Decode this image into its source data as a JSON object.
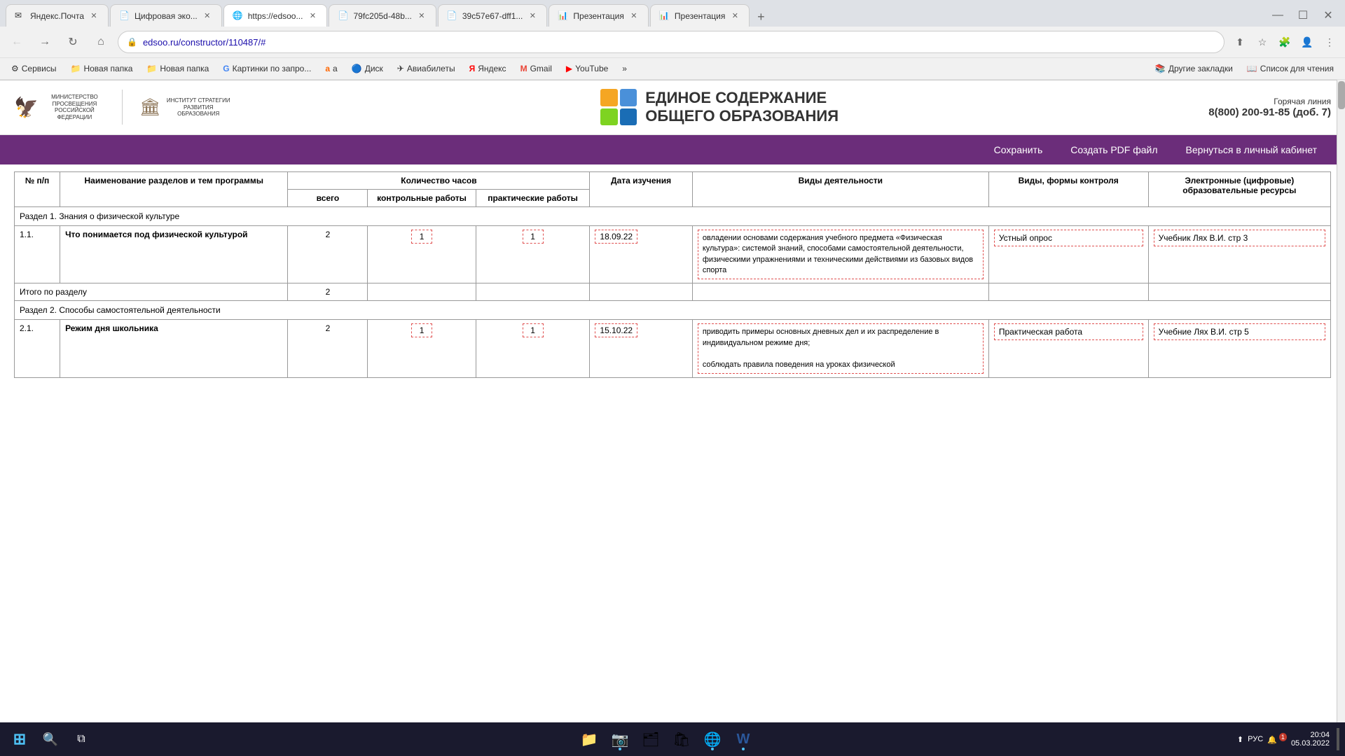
{
  "browser": {
    "tabs": [
      {
        "id": 1,
        "label": "Яндекс.Почта",
        "favicon": "✉",
        "active": false
      },
      {
        "id": 2,
        "label": "Цифровая эко...",
        "favicon": "📄",
        "active": false
      },
      {
        "id": 3,
        "label": "https://edsoo...",
        "favicon": "🌐",
        "active": true
      },
      {
        "id": 4,
        "label": "79fc205d-48b...",
        "favicon": "📄",
        "active": false
      },
      {
        "id": 5,
        "label": "39c57e67-dff1...",
        "favicon": "📄",
        "active": false
      },
      {
        "id": 6,
        "label": "Презентация",
        "favicon": "📊",
        "active": false
      },
      {
        "id": 7,
        "label": "Презентация",
        "favicon": "📊",
        "active": false
      }
    ],
    "address": "edsoo.ru/constructor/110487/#",
    "bookmarks": [
      {
        "label": "Сервисы",
        "favicon": "⚙"
      },
      {
        "label": "Новая папка",
        "favicon": "📁"
      },
      {
        "label": "Новая папка",
        "favicon": "📁"
      },
      {
        "label": "Картинки по запро...",
        "favicon": "G"
      },
      {
        "label": "a",
        "favicon": "🅰"
      },
      {
        "label": "Диск",
        "favicon": "🔵"
      },
      {
        "label": "Авиабилеты",
        "favicon": "✈"
      },
      {
        "label": "Яндекс",
        "favicon": "Я"
      },
      {
        "label": "Gmail",
        "favicon": "M"
      },
      {
        "label": "YouTube",
        "favicon": "▶"
      },
      {
        "label": "»",
        "favicon": ""
      },
      {
        "label": "Другие закладки",
        "favicon": "📚"
      },
      {
        "label": "Список для чтения",
        "favicon": "📖"
      }
    ]
  },
  "site": {
    "ministry_name": "МИНИСТЕРСТВО ПРОСВЕЩЕНИЯ РОССИЙСКОЙ ФЕДЕРАЦИИ",
    "institute_name": "ИНСТИТУТ СТРАТЕГИИ РАЗВИТИЯ ОБРАЗОВАНИЯ",
    "title_line1": "ЕДИНОЕ СОДЕРЖАНИЕ",
    "title_line2": "ОБЩЕГО ОБРАЗОВАНИЯ",
    "hotline_label": "Горячая линия",
    "hotline_number": "8(800) 200-91-85",
    "hotline_ext": "(доб. 7)"
  },
  "nav": {
    "items": [
      "Сохранить",
      "Создать PDF файл",
      "Вернуться в личный кабинет"
    ]
  },
  "table": {
    "headers": {
      "num": "№ п/п",
      "name": "Наименование разделов и тем программы",
      "hours_group": "Количество часов",
      "hours_total": "всего",
      "hours_control": "контрольные работы",
      "hours_practice": "практические работы",
      "date": "Дата изучения",
      "activity": "Виды деятельности",
      "control_types": "Виды, формы контроля",
      "resources": "Электронные (цифровые) образовательные ресурсы"
    },
    "sections": [
      {
        "id": "section1",
        "label": "Раздел 1. Знания о физической культуре",
        "rows": [
          {
            "num": "1.1.",
            "name": "Что понимается под физической культурой",
            "hours_total": "2",
            "hours_control": "1",
            "hours_practice": "1",
            "date": "18.09.22",
            "activity": "овладении основами содержания учебного предмета «Физическая культура»: системой знаний, способами самостоятельной деятельности, физическими упражнениями и техническими действиями из базовых видов спорта",
            "control_type": "Устный опрос",
            "resource": "Учебник Лях В.И. стр 3"
          }
        ],
        "total_hours": "2"
      },
      {
        "id": "section2",
        "label": "Раздел 2. Способы самостоятельной деятельности",
        "rows": [
          {
            "num": "2.1.",
            "name": "Режим дня школьника",
            "hours_total": "2",
            "hours_control": "1",
            "hours_practice": "1",
            "date": "15.10.22",
            "activity": "приводить примеры основных дневных дел и их распределение в индивидуальном режиме дня;\n\nсоблюдать правила поведения на уроках физической",
            "control_type": "Практическая работа",
            "resource": "Учебние Лях В.И. стр 5"
          }
        ]
      }
    ]
  },
  "taskbar": {
    "time": "20:04",
    "date": "05.03.2022",
    "lang": "РУС",
    "notification_count": "1"
  },
  "colors": {
    "purple_nav": "#6B2D7A",
    "grid_red": "#e05050",
    "grid_orange": "#f5a623",
    "grid_blue": "#4a90d9",
    "grid_green": "#7ed321",
    "grid_yellow": "#f8e71c",
    "grid_book_blue": "#1a6db5",
    "grid_book_red": "#c0392b"
  }
}
